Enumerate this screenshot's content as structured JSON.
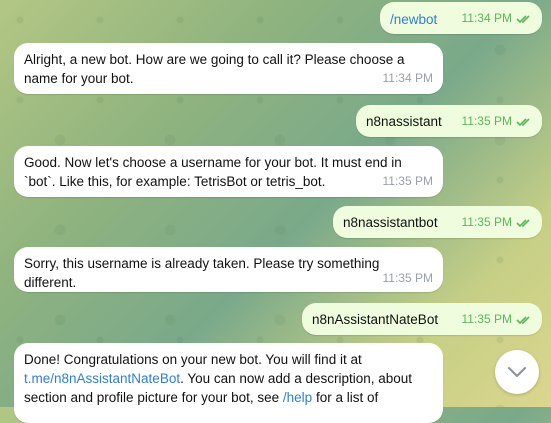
{
  "messages": [
    {
      "dir": "out",
      "text": "/newbot",
      "time": "11:34 PM"
    },
    {
      "dir": "in",
      "text": "Alright, a new bot. How are we going to call it? Please choose a name for your bot.",
      "time": "11:34 PM"
    },
    {
      "dir": "out",
      "text": "n8nassistant",
      "time": "11:35 PM"
    },
    {
      "dir": "in",
      "text": "Good. Now let's choose a username for your bot. It must end in `bot`. Like this, for example: TetrisBot or tetris_bot.",
      "time": "11:35 PM"
    },
    {
      "dir": "out",
      "text": "n8nassistantbot",
      "time": "11:35 PM"
    },
    {
      "dir": "in",
      "text": "Sorry, this username is already taken. Please try something different.",
      "time": "11:35 PM"
    },
    {
      "dir": "out",
      "text": "n8nAssistantNateBot",
      "time": "11:35 PM"
    },
    {
      "dir": "in",
      "text_parts": [
        "Done! Congratulations on your new bot. You will find it at ",
        "t.me/n8nAssistantNateBot",
        ". You can now add a description, about section and profile picture for your bot, see ",
        "/help",
        " for a list of"
      ]
    }
  ],
  "colors": {
    "incoming": "#ffffff",
    "outgoing": "#effdde",
    "link": "#2f7fd0",
    "checks": "#5cb55a"
  },
  "icons": {
    "read_receipt": "double-check-icon",
    "scroll_down": "chevron-down-icon"
  }
}
